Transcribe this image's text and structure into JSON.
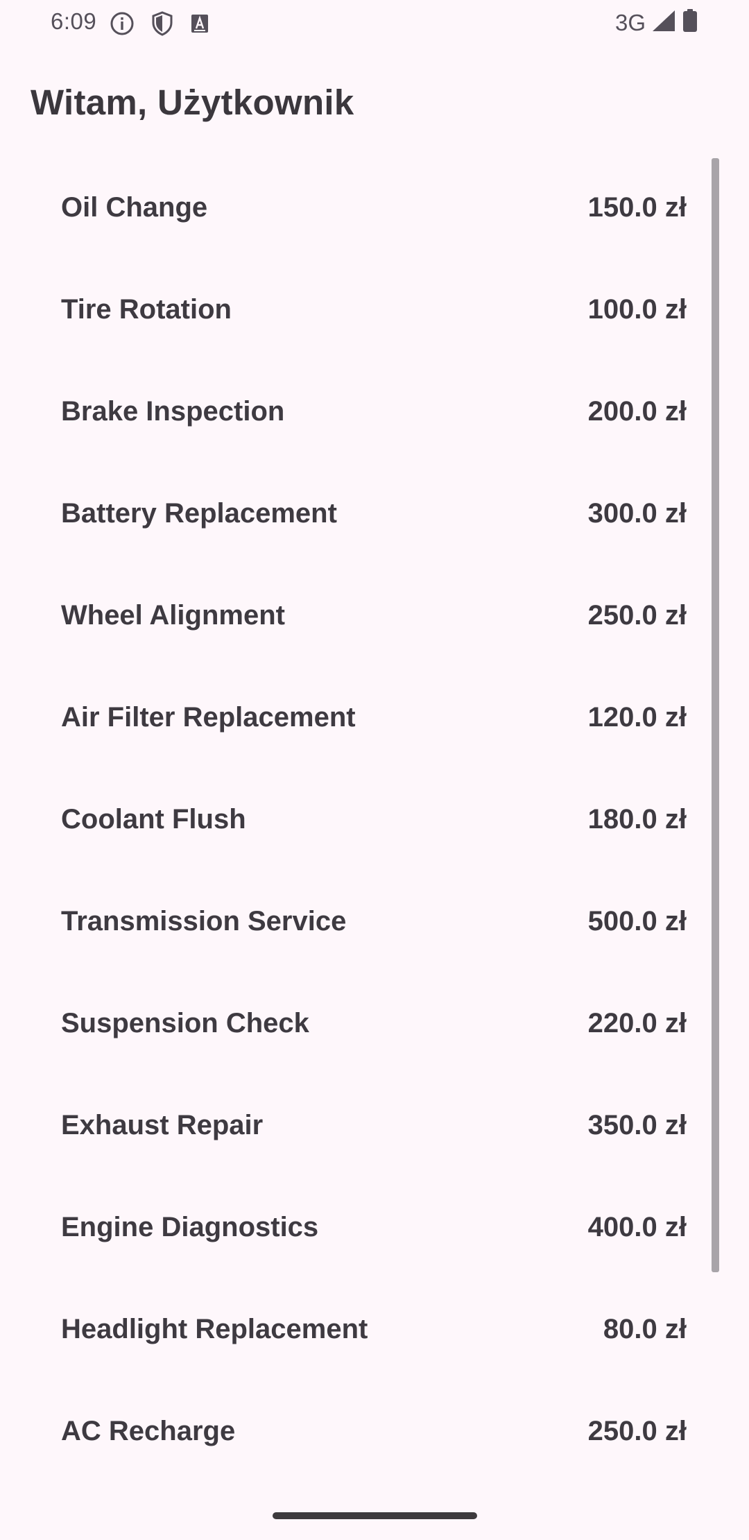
{
  "status_bar": {
    "time": "6:09",
    "left_icons": [
      "info-icon",
      "shield-icon",
      "text-badge-icon"
    ],
    "network": "3G",
    "right_icons": [
      "signal-icon",
      "battery-icon"
    ]
  },
  "header": {
    "greeting": "Witam, Użytkownik"
  },
  "services": [
    {
      "name": "Oil Change",
      "price": "150.0 zł"
    },
    {
      "name": "Tire Rotation",
      "price": "100.0 zł"
    },
    {
      "name": "Brake Inspection",
      "price": "200.0 zł"
    },
    {
      "name": "Battery Replacement",
      "price": "300.0 zł"
    },
    {
      "name": "Wheel Alignment",
      "price": "250.0 zł"
    },
    {
      "name": "Air Filter Replacement",
      "price": "120.0 zł"
    },
    {
      "name": "Coolant Flush",
      "price": "180.0 zł"
    },
    {
      "name": "Transmission Service",
      "price": "500.0 zł"
    },
    {
      "name": "Suspension Check",
      "price": "220.0 zł"
    },
    {
      "name": "Exhaust Repair",
      "price": "350.0 zł"
    },
    {
      "name": "Engine Diagnostics",
      "price": "400.0 zł"
    },
    {
      "name": "Headlight Replacement",
      "price": "80.0 zł"
    },
    {
      "name": "AC Recharge",
      "price": "250.0 zł"
    }
  ],
  "colors": {
    "background": "#fef7fb",
    "text": "#3e3a41",
    "scrollbar": "#a8a4a9"
  }
}
